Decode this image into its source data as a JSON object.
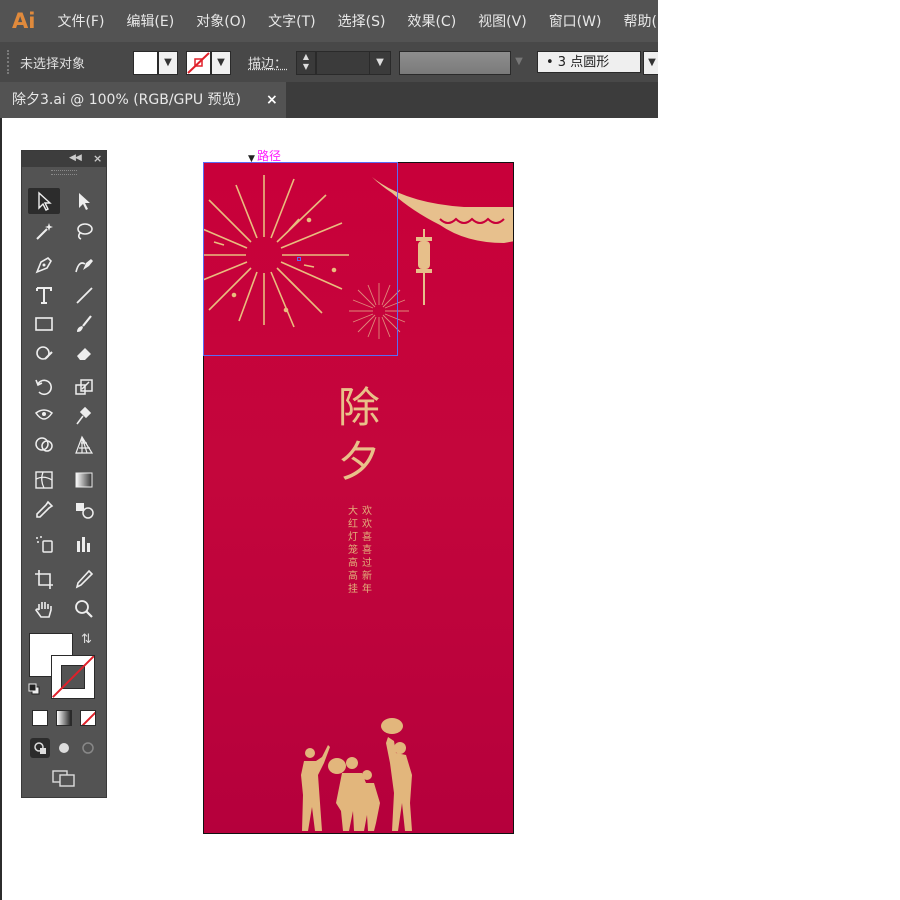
{
  "app": {
    "logo": "Ai",
    "menu": [
      "文件(F)",
      "编辑(E)",
      "对象(O)",
      "文字(T)",
      "选择(S)",
      "效果(C)",
      "视图(V)",
      "窗口(W)",
      "帮助("
    ]
  },
  "control_bar": {
    "selection_status": "未选择对象",
    "stroke_label": "描边：",
    "brush_value": "•  3 点圆形"
  },
  "document_tab": {
    "title": "除夕3.ai @ 100% (RGB/GPU 预览)",
    "close_glyph": "×"
  },
  "canvas": {
    "hover_hint": "路径",
    "artwork": {
      "title": "除夕",
      "line_left": "大红灯笼高高挂",
      "line_right": "欢欢喜喜过新年"
    }
  },
  "colors": {
    "artboard_red": "#c4063c",
    "gold": "#e9c089",
    "selection_blue": "#5a6cf5",
    "hint_magenta": "#ff1cff"
  },
  "toolbox_tools": [
    "selection-tool",
    "direct-selection-tool",
    "magic-wand-tool",
    "lasso-tool",
    "pen-tool",
    "curvature-tool",
    "type-tool",
    "line-segment-tool",
    "rectangle-tool",
    "paintbrush-tool",
    "shaper-tool",
    "eraser-tool",
    "rotate-tool",
    "scale-tool",
    "width-tool",
    "puppet-warp-tool",
    "shape-builder-tool",
    "perspective-grid-tool",
    "mesh-tool",
    "gradient-tool",
    "eyedropper-tool",
    "blend-tool",
    "symbol-sprayer-tool",
    "column-graph-tool",
    "artboard-tool",
    "slice-tool",
    "hand-tool",
    "zoom-tool"
  ]
}
